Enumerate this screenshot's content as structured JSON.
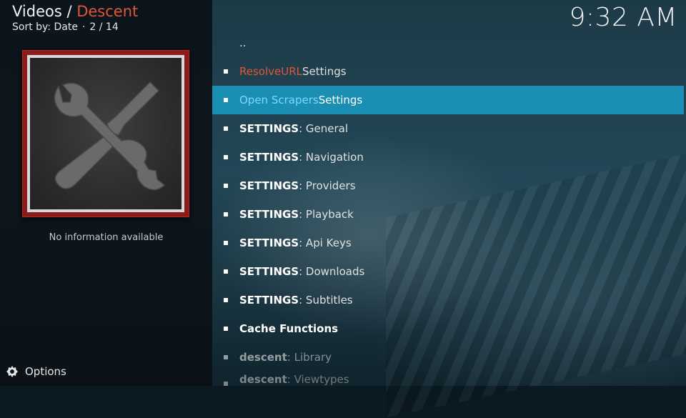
{
  "header": {
    "section": "Videos",
    "separator": " / ",
    "addon": "Descent",
    "sort_label": "Sort by: Date",
    "dot": "·",
    "position": "2 / 14"
  },
  "clock": "9:32 AM",
  "info": {
    "no_info": "No information available"
  },
  "footer": {
    "options_label": "Options"
  },
  "list": {
    "parent": "..",
    "items": [
      {
        "key": "ResolveURL",
        "rest": " Settings"
      },
      {
        "key": "Open Scrapers",
        "rest": " Settings"
      },
      {
        "key": "SETTINGS",
        "rest": " : General"
      },
      {
        "key": "SETTINGS",
        "rest": " : Navigation"
      },
      {
        "key": "SETTINGS",
        "rest": " : Providers"
      },
      {
        "key": "SETTINGS",
        "rest": " : Playback"
      },
      {
        "key": "SETTINGS",
        "rest": " : Api Keys"
      },
      {
        "key": "SETTINGS",
        "rest": " : Downloads"
      },
      {
        "key": "SETTINGS",
        "rest": " : Subtitles"
      },
      {
        "key": "Cache Functions",
        "rest": ""
      },
      {
        "key": "descent",
        "rest": " : Library"
      },
      {
        "key": "descent",
        "rest": " : Viewtypes"
      }
    ]
  },
  "colors": {
    "accent_red": "#e0553a",
    "accent_blue": "#7fd6ff",
    "selection": "#1b8fb3",
    "thumb_border": "#8c1b1b"
  },
  "icons": {
    "options": "options-icon",
    "thumbnail": "tools-wrench-screwdriver-icon"
  }
}
